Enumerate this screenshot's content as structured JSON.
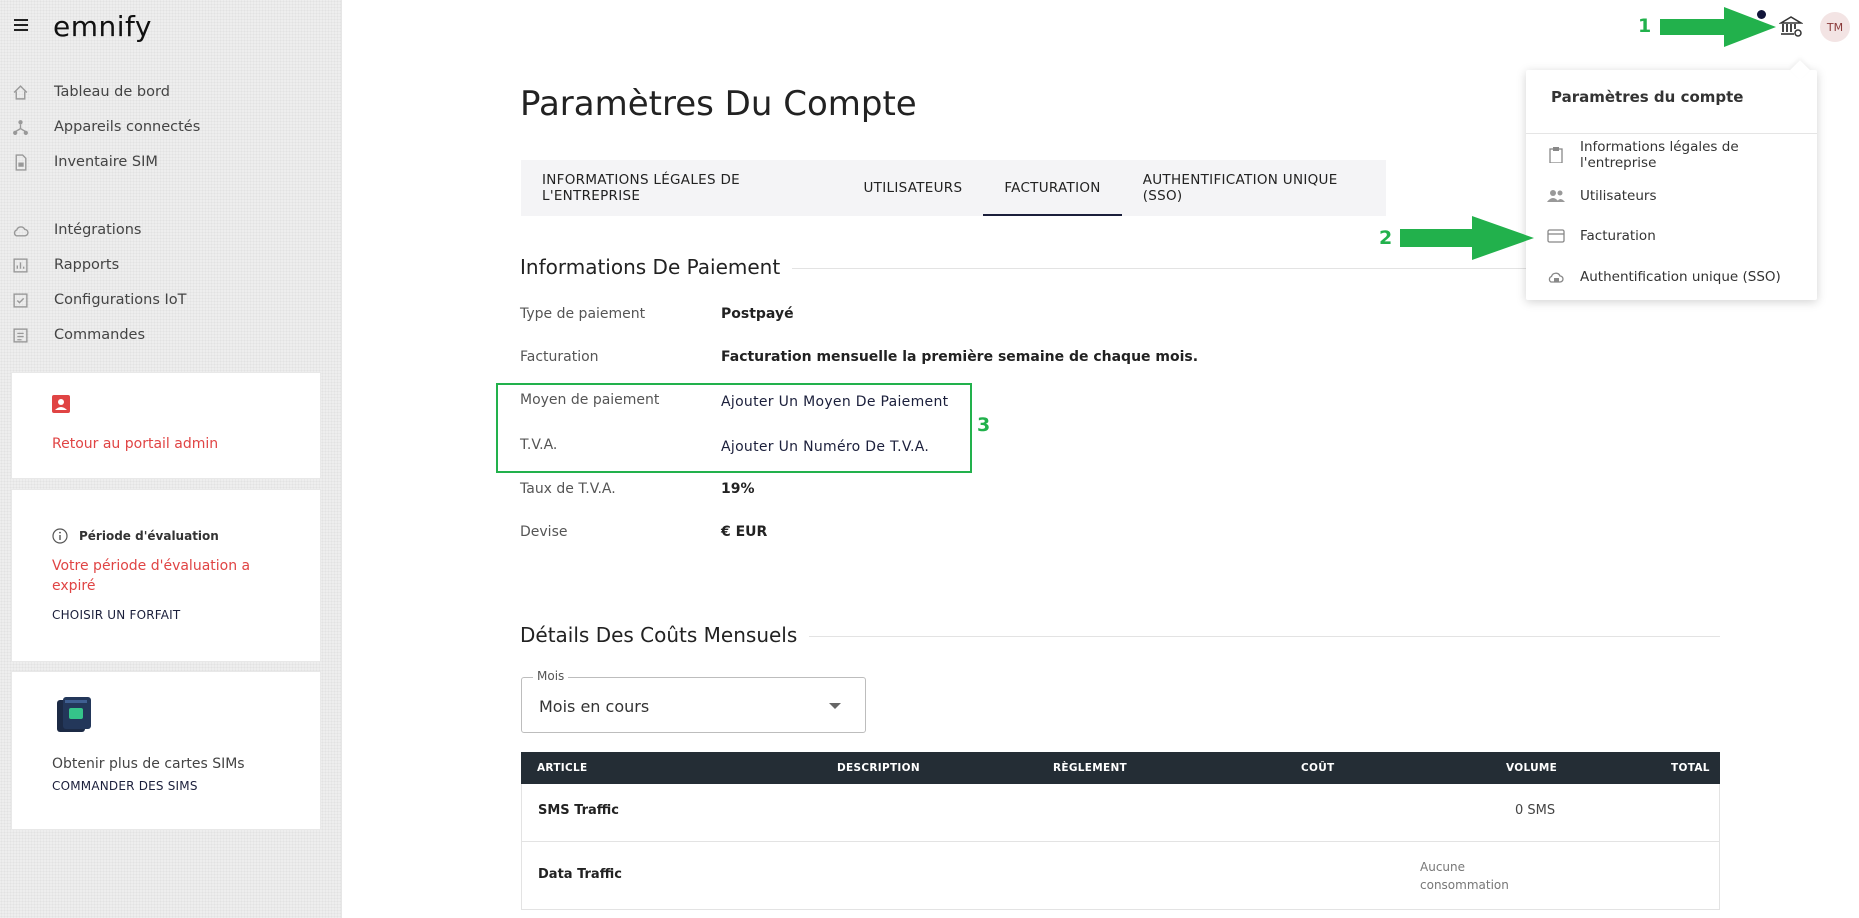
{
  "app": {
    "logo_text": "emnify"
  },
  "sidebar": {
    "nav": [
      {
        "label": "Tableau de bord",
        "icon": "home-icon"
      },
      {
        "label": "Appareils connectés",
        "icon": "network-icon"
      },
      {
        "label": "Inventaire SIM",
        "icon": "sim-card-icon"
      },
      {
        "label": "Intégrations",
        "icon": "cloud-icon"
      },
      {
        "label": "Rapports",
        "icon": "report-icon"
      },
      {
        "label": "Configurations IoT",
        "icon": "checklist-icon"
      },
      {
        "label": "Commandes",
        "icon": "document-icon"
      }
    ],
    "admin_card": {
      "link": "Retour au portail admin"
    },
    "trial_card": {
      "title": "Période d'évaluation",
      "message": "Votre période d'évaluation a expiré",
      "action": "CHOISIR UN FORFAIT"
    },
    "sims_card": {
      "text": "Obtenir plus de cartes SIMs",
      "action": "COMMANDER DES SIMS"
    }
  },
  "topbar": {
    "avatar_initials": "TM"
  },
  "annotations": {
    "n1": "1",
    "n2": "2",
    "n3": "3",
    "color": "#22b14c"
  },
  "page": {
    "title": "Paramètres Du Compte",
    "tabs": [
      "INFORMATIONS LÉGALES DE L'ENTREPRISE",
      "UTILISATEURS",
      "FACTURATION",
      "AUTHENTIFICATION UNIQUE (SSO)"
    ],
    "active_tab": "FACTURATION"
  },
  "payment": {
    "title": "Informations De Paiement",
    "type_label": "Type de paiement",
    "type_value": "Postpayé",
    "billing_label": "Facturation",
    "billing_value": "Facturation mensuelle la première semaine de chaque mois.",
    "method_label": "Moyen de paiement",
    "method_link": "Ajouter Un Moyen De Paiement",
    "vat_label": "T.V.A.",
    "vat_link": "Ajouter Un Numéro De T.V.A.",
    "vat_rate_label": "Taux de T.V.A.",
    "vat_rate_value": "19%",
    "currency_label": "Devise",
    "currency_value": "€ EUR"
  },
  "monthly": {
    "title": "Détails Des Coûts Mensuels",
    "select_legend": "Mois",
    "select_value": "Mois en cours",
    "columns": [
      "ARTICLE",
      "DESCRIPTION",
      "RÈGLEMENT",
      "COÛT",
      "VOLUME",
      "TOTAL"
    ],
    "rows": [
      {
        "article": "SMS Traffic",
        "volume": "0 SMS"
      },
      {
        "article": "Data Traffic",
        "volume": "Aucune consommation"
      }
    ]
  },
  "dropdown": {
    "header": "Paramètres du compte",
    "items": [
      {
        "label": "Informations légales de l'entreprise",
        "icon": "clipboard-icon"
      },
      {
        "label": "Utilisateurs",
        "icon": "users-icon"
      },
      {
        "label": "Facturation",
        "icon": "credit-card-icon"
      },
      {
        "label": "Authentification unique (SSO)",
        "icon": "cloud-lock-icon"
      }
    ]
  }
}
